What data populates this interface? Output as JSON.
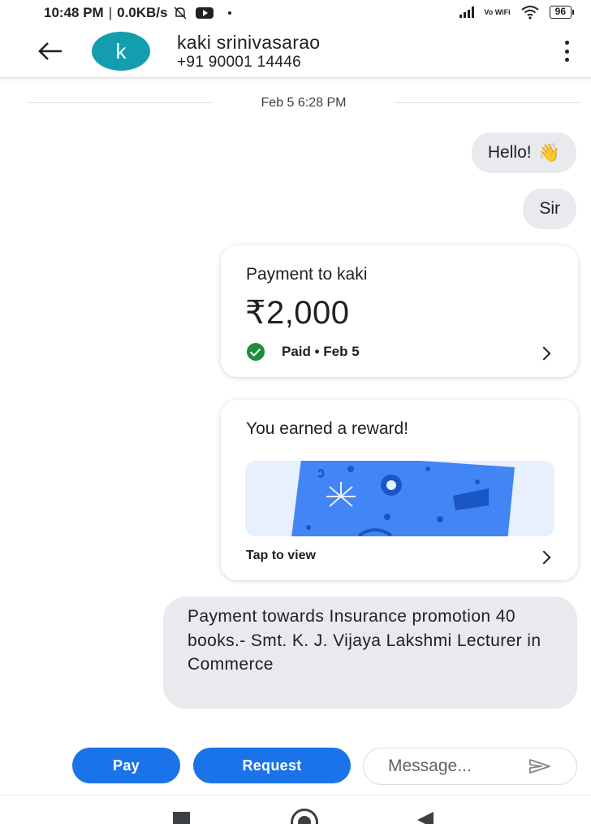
{
  "status_bar": {
    "time": "10:48 PM",
    "speed": "0.0KB/s",
    "network_type": "Vo WiFi",
    "battery": "96"
  },
  "header": {
    "avatar_letter": "k",
    "avatar_color": "#129eaf",
    "contact_name": "kaki srinivasarao",
    "contact_phone": "+91 90001 14446"
  },
  "conversation": {
    "date_divider": "Feb 5 6:28 PM",
    "messages": [
      {
        "text": "Hello!",
        "emoji": "👋"
      },
      {
        "text": "Sir"
      }
    ],
    "payment_card": {
      "title": "Payment to kaki",
      "amount": "₹2,000",
      "status": "Paid • Feb 5",
      "status_color": "#1e8e3e"
    },
    "reward_card": {
      "title": "You earned a reward!",
      "action": "Tap to view"
    },
    "note": "Payment towards Insurance promotion 40 books.- Smt. K. J. Vijaya Lakshmi Lecturer in Commerce"
  },
  "composer": {
    "pay_label": "Pay",
    "request_label": "Request",
    "message_placeholder": "Message...",
    "accent_color": "#1a73e8"
  }
}
